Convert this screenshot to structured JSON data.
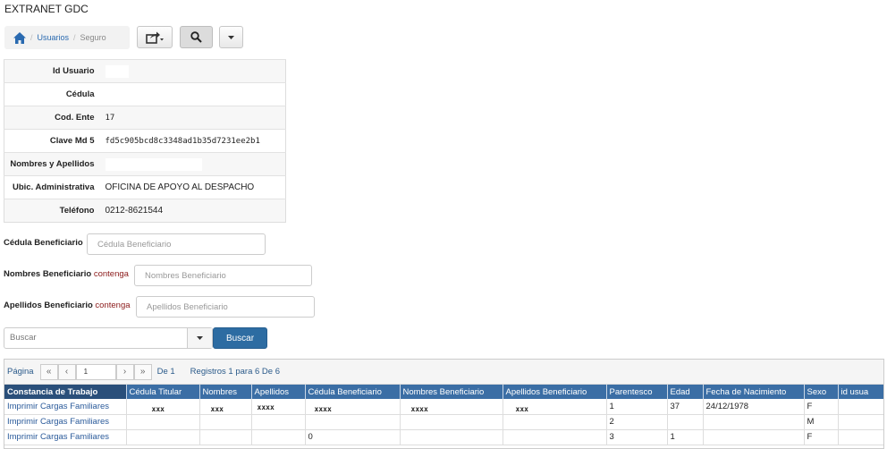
{
  "app": {
    "title": "EXTRANET GDC"
  },
  "breadcrumb": {
    "items": [
      "Usuarios",
      "Seguro"
    ]
  },
  "toolbar": {
    "export_icon": "share-export-icon",
    "search_icon": "search-icon",
    "dropdown_icon": "caret-down-icon"
  },
  "user_info": {
    "rows": [
      {
        "label": "Id Usuario",
        "value": ""
      },
      {
        "label": "Cédula",
        "value": ""
      },
      {
        "label": "Cod. Ente",
        "value": "17"
      },
      {
        "label": "Clave Md 5",
        "value": "fd5c905bcd8c3348ad1b35d7231ee2b1"
      },
      {
        "label": "Nombres y Apellidos",
        "value": ""
      },
      {
        "label": "Ubic. Administrativa",
        "value": "OFICINA DE APOYO AL DESPACHO"
      },
      {
        "label": "Teléfono",
        "value": "0212-8621544"
      }
    ]
  },
  "filters": {
    "cedula": {
      "label": "Cédula Beneficiario",
      "placeholder": "Cédula Beneficiario"
    },
    "nombres": {
      "label": "Nombres Beneficiario",
      "qualifier": "contenga",
      "placeholder": "Nombres Beneficiario"
    },
    "apellidos": {
      "label": "Apellidos Beneficiario",
      "qualifier": "contenga",
      "placeholder": "Apellidos Beneficiario"
    },
    "search_select": "Buscar",
    "search_button": "Buscar"
  },
  "pager": {
    "label": "Página",
    "current_page": "1",
    "of_text": "De 1",
    "records_text": "Registros 1 para 6 De 6"
  },
  "grid": {
    "columns": [
      "Constancia de Trabajo",
      "Cédula Titular",
      "Nombres",
      "Apellidos",
      "Cédula Beneficiario",
      "Nombres Beneficiario",
      "Apellidos Beneficiario",
      "Parentesco",
      "Edad",
      "Fecha de Nacimiento",
      "Sexo",
      "id usua"
    ],
    "rows": [
      [
        "Imprimir Cargas Familiares",
        "xxx",
        "xxx",
        "xxxx",
        "xxxx",
        "xxxx",
        "xxx",
        "1",
        "37",
        "24/12/1978",
        "F",
        ""
      ],
      [
        "Imprimir Cargas Familiares",
        "",
        "",
        "",
        "",
        "",
        "",
        "2",
        "",
        "",
        "M",
        ""
      ],
      [
        "Imprimir Cargas Familiares",
        "",
        "",
        "",
        "0",
        "",
        "",
        "3",
        "1",
        "",
        "F",
        ""
      ]
    ]
  },
  "colors": {
    "accent": "#2d6ca2",
    "header": "#3b6ea5",
    "link": "#2a5a9a",
    "qualifier": "#8b1a1a"
  }
}
